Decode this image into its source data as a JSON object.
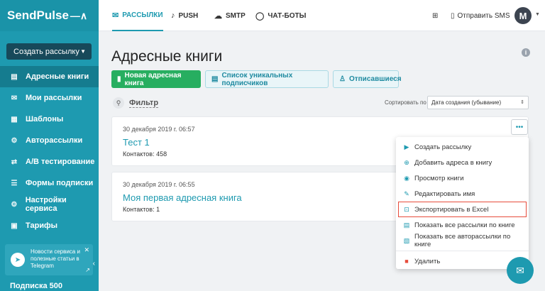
{
  "logo": {
    "text": "SendPulse",
    "mark": "—∧"
  },
  "sidebar": {
    "create_label": "Создать рассылку",
    "items": [
      {
        "label": "Адресные книги",
        "icon": "address-book-icon",
        "glyph": "▤",
        "active": true
      },
      {
        "label": "Мои рассылки",
        "icon": "mailings-icon",
        "glyph": "✉",
        "active": false
      },
      {
        "label": "Шаблоны",
        "icon": "templates-icon",
        "glyph": "▦",
        "active": false
      },
      {
        "label": "Авторассылки",
        "icon": "automation-icon",
        "glyph": "⚙",
        "active": false
      },
      {
        "label": "A/B тестирование",
        "icon": "ab-test-icon",
        "glyph": "⇄",
        "active": false
      },
      {
        "label": "Формы подписки",
        "icon": "forms-icon",
        "glyph": "☰",
        "active": false
      },
      {
        "label": "Настройки сервиса",
        "icon": "settings-icon",
        "glyph": "⚙",
        "active": false
      },
      {
        "label": "Тарифы",
        "icon": "pricing-icon",
        "glyph": "▣",
        "active": false
      }
    ],
    "telegram_text": "Новости сервиса и полезные статьи в Telegram",
    "plan_label": "Подписка 500"
  },
  "topbar": {
    "tabs": [
      {
        "label": "РАССЫЛКИ",
        "icon": "email-icon",
        "glyph": "✉",
        "active": true
      },
      {
        "label": "PUSH",
        "icon": "bell-icon",
        "glyph": "🔔",
        "active": false
      },
      {
        "label": "SMTP",
        "icon": "cloud-icon",
        "glyph": "☁",
        "active": false
      },
      {
        "label": "ЧАТ-БОТЫ",
        "icon": "chat-icon",
        "glyph": "◯",
        "active": false
      }
    ],
    "send_sms_label": "Отправить SMS",
    "avatar_letter": "M"
  },
  "main": {
    "title": "Адресные книги",
    "buttons": {
      "new_book": "Новая адресная книга",
      "unique_subscribers": "Список уникальных подписчиков",
      "unsubscribed": "Отписавшиеся"
    },
    "filter_label": "Фильтр",
    "sort_label": "Сортировать по",
    "sort_value": "Дата создания (убывание)",
    "books": [
      {
        "date": "30 декабря 2019 г. 06:57",
        "name": "Тест 1",
        "contacts": "Контактов: 458"
      },
      {
        "date": "30 декабря 2019 г. 06:55",
        "name": "Моя первая адресная книга",
        "contacts": "Контактов: 1"
      }
    ]
  },
  "dropdown": {
    "items": [
      {
        "label": "Создать рассылку",
        "icon": "play-icon",
        "glyph": "▶"
      },
      {
        "label": "Добавить адреса в книгу",
        "icon": "plus-circle-icon",
        "glyph": "⊕"
      },
      {
        "label": "Просмотр книги",
        "icon": "eye-icon",
        "glyph": "◉"
      },
      {
        "label": "Редактировать имя",
        "icon": "pencil-icon",
        "glyph": "✎"
      },
      {
        "label": "Экспортировать в Excel",
        "icon": "export-icon",
        "glyph": "⊡",
        "highlight": true
      },
      {
        "label": "Показать все рассылки по книге",
        "icon": "list-icon",
        "glyph": "▤"
      },
      {
        "label": "Показать все авторассылки по книге",
        "icon": "auto-list-icon",
        "glyph": "▧"
      },
      {
        "label": "Удалить",
        "icon": "trash-icon",
        "glyph": "🗑",
        "danger": true
      }
    ]
  },
  "colors": {
    "accent": "#1e9ab0",
    "green": "#27ae60",
    "sidebar": "#1e9ab0",
    "danger": "#e74c3c"
  }
}
